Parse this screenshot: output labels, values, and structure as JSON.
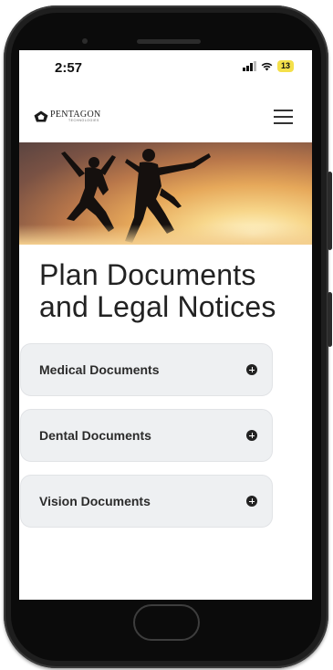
{
  "status_bar": {
    "time": "2:57",
    "battery": "13",
    "battery_color": "#f4e04a"
  },
  "header": {
    "logo_name": "PENTAGON",
    "logo_sub": "TECHNOLOGIES",
    "logo_icon": "pentagon-house-icon",
    "menu_icon": "hamburger-menu-icon"
  },
  "hero": {
    "image": "two people jumping silhouetted against sunset"
  },
  "main": {
    "title": "Plan Documents and Legal Notices",
    "sections": [
      {
        "label": "Medical Documents",
        "icon": "plus-circle-icon"
      },
      {
        "label": "Dental Documents",
        "icon": "plus-circle-icon"
      },
      {
        "label": "Vision Documents",
        "icon": "plus-circle-icon"
      }
    ]
  }
}
